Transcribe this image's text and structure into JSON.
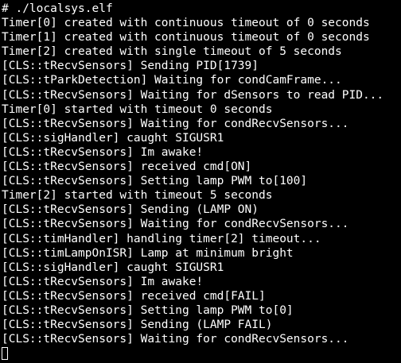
{
  "terminal": {
    "lines": [
      "# ./localsys.elf",
      "Timer[0] created with continuous timeout of 0 seconds",
      "Timer[1] created with continuous timeout of 0 seconds",
      "Timer[2] created with single timeout of 5 seconds",
      "[CLS::tRecvSensors] Sending PID[1739]",
      "[CLS::tParkDetection] Waiting for condCamFrame...",
      "[CLS::tRecvSensors] Waiting for dSensors to read PID...",
      "Timer[0] started with timeout 0 seconds",
      "[CLS::tRecvSensors] Waiting for condRecvSensors...",
      "[CLS::sigHandler] caught SIGUSR1",
      "[CLS::tRecvSensors] Im awake!",
      "[CLS::tRecvSensors] received cmd[ON]",
      "[CLS::tRecvSensors] Setting lamp PWM to[100]",
      "Timer[2] started with timeout 5 seconds",
      "[CLS::tRecvSensors] Sending (LAMP ON)",
      "[CLS::tRecvSensors] Waiting for condRecvSensors...",
      "[CLS::timHandler] handling timer[2] timeout...",
      "[CLS::timLampOnISR] Lamp at minimum bright",
      "[CLS::sigHandler] caught SIGUSR1",
      "[CLS::tRecvSensors] Im awake!",
      "[CLS::tRecvSensors] received cmd[FAIL]",
      "[CLS::tRecvSensors] Setting lamp PWM to[0]",
      "[CLS::tRecvSensors] Sending (LAMP FAIL)",
      "[CLS::tRecvSensors] Waiting for condRecvSensors..."
    ],
    "colors": {
      "background": "#000000",
      "foreground": "#ffffff"
    }
  }
}
